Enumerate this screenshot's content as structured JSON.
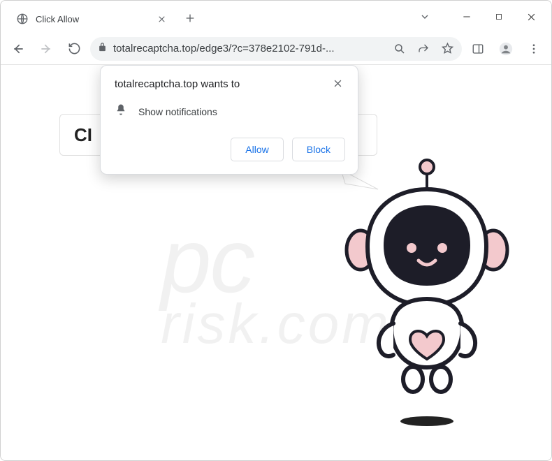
{
  "window": {
    "tab_title": "Click Allow"
  },
  "toolbar": {
    "url": "totalrecaptcha.top/edge3/?c=378e2102-791d-..."
  },
  "page": {
    "card_text_fragment": "CI"
  },
  "permission": {
    "origin_text": "totalrecaptcha.top wants to",
    "item_label": "Show notifications",
    "allow_label": "Allow",
    "block_label": "Block"
  },
  "watermark": {
    "line1": "pc",
    "line2": "risk.com"
  }
}
